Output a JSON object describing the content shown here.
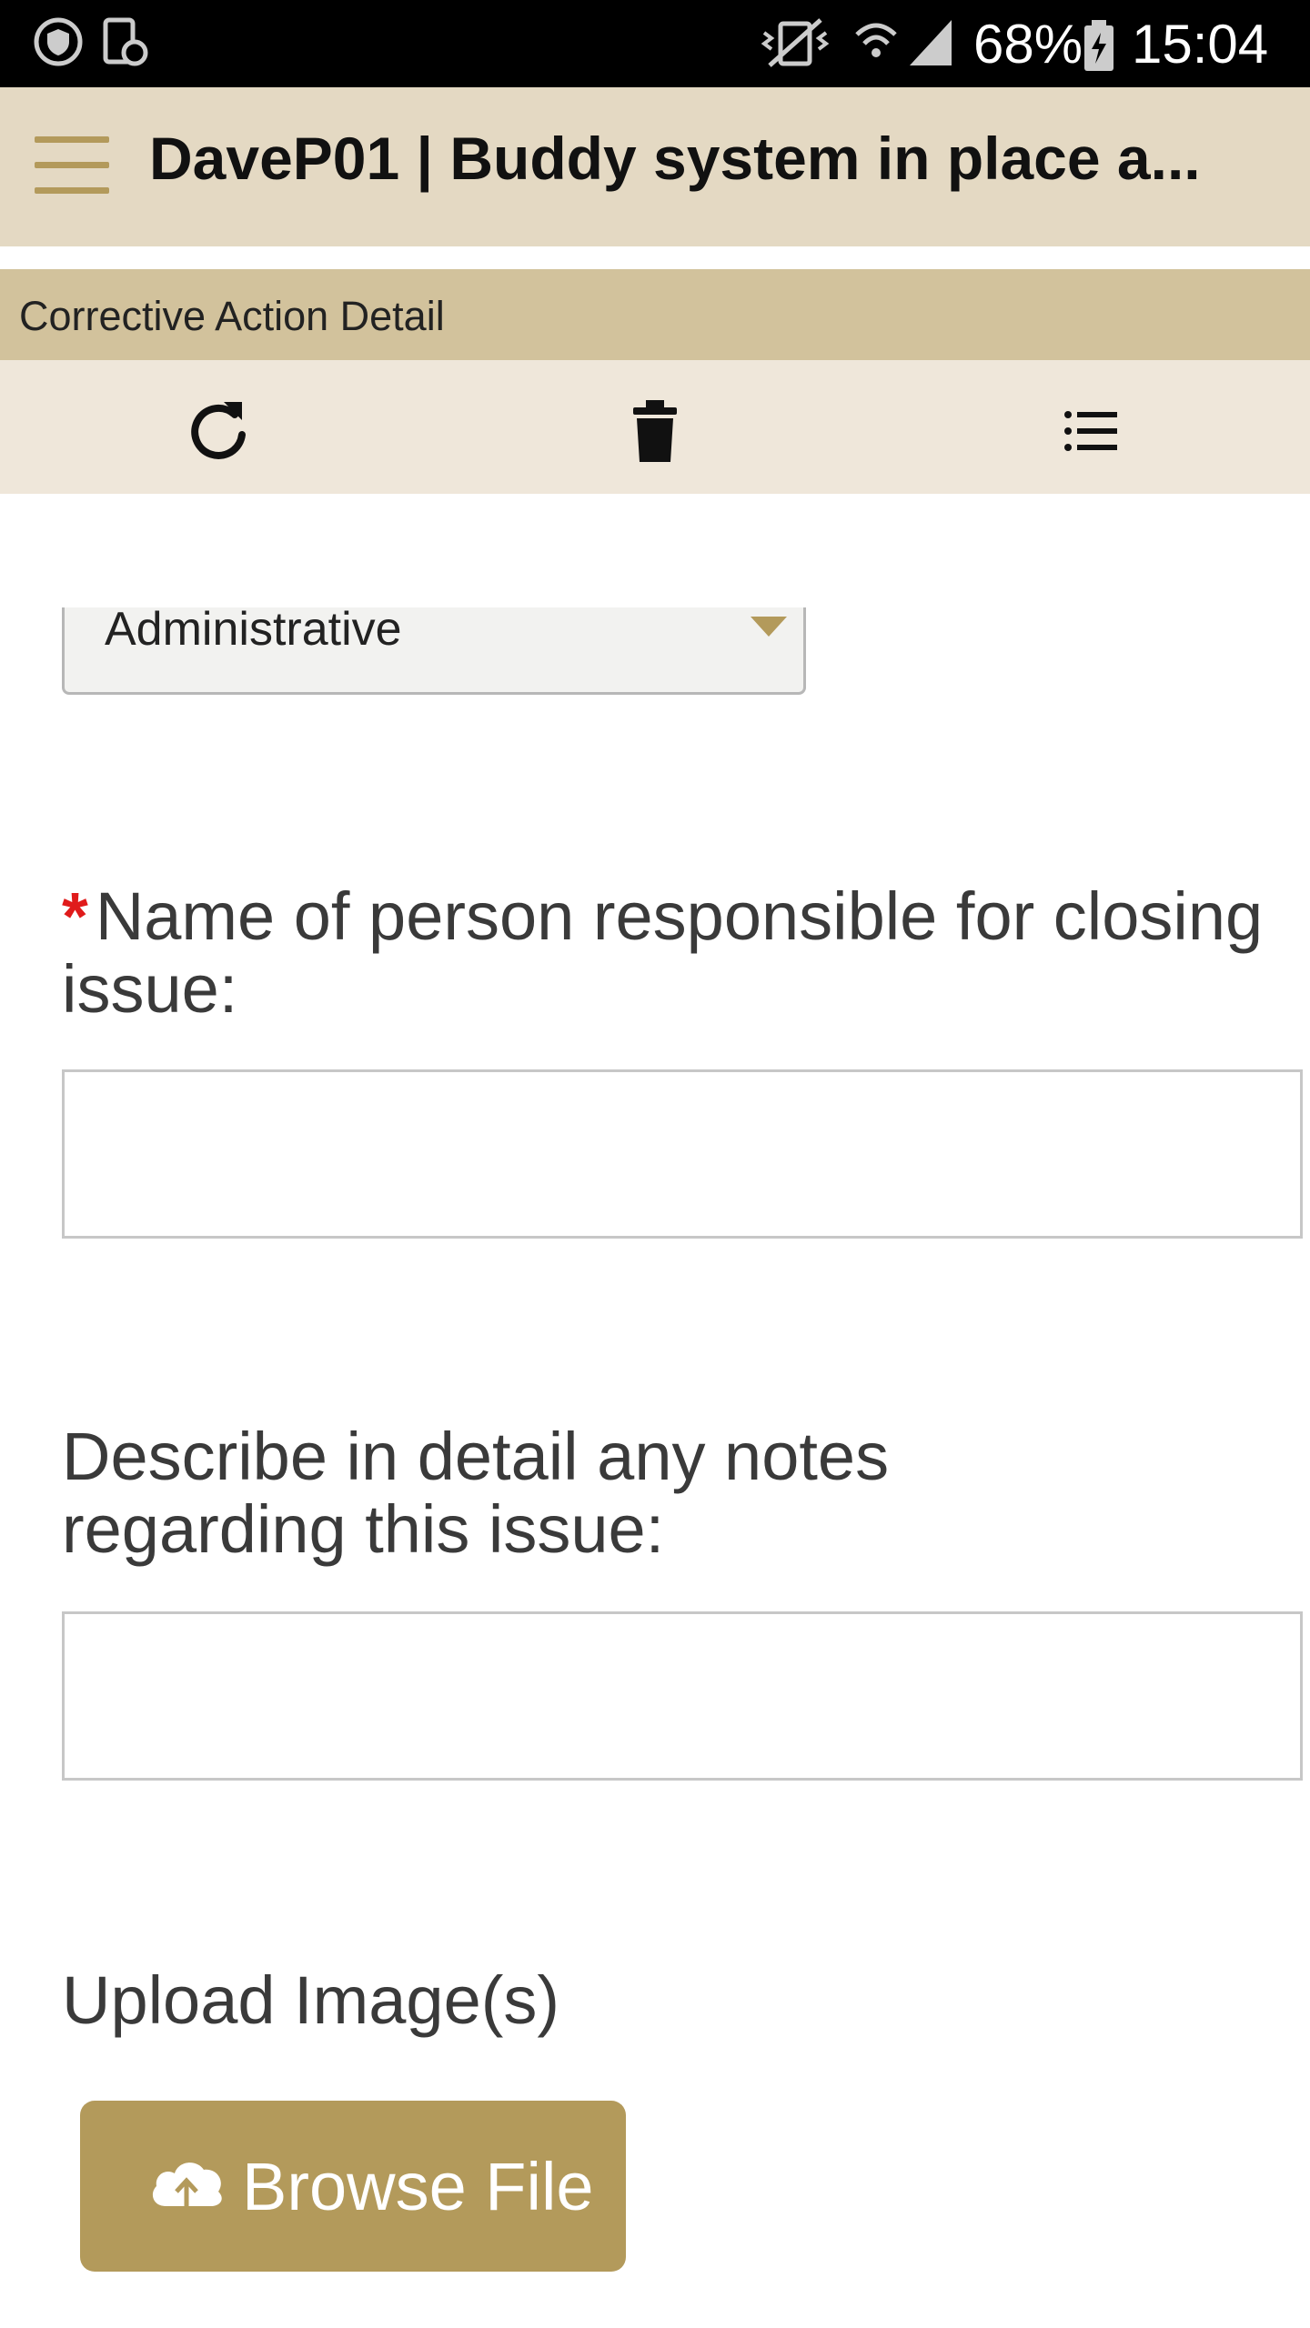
{
  "status_bar": {
    "battery_percent": "68%",
    "time": "15:04",
    "icons": [
      "shield-icon",
      "screen-lock-icon",
      "mute-vibrate-icon",
      "wifi-icon",
      "signal-icon",
      "battery-charging-icon"
    ]
  },
  "header": {
    "title": "DaveP01 | Buddy system in place a...",
    "menu_icon": "hamburger-menu-icon",
    "accent_color": "#b39a5b",
    "background": "#e4d9c3"
  },
  "section": {
    "title": "Corrective Action Detail"
  },
  "toolbar": {
    "buttons": [
      "refresh-icon",
      "trash-icon",
      "list-icon"
    ]
  },
  "form": {
    "category_select": {
      "value": "Administrative"
    },
    "responsible_person": {
      "required_marker": "*",
      "label": "Name of person responsible for closing issue:",
      "value": ""
    },
    "notes": {
      "label": "Describe in detail any notes regarding this issue:",
      "value": ""
    },
    "upload": {
      "label": "Upload Image(s)",
      "button_label": "Browse File",
      "button_icon": "cloud-upload-icon"
    }
  }
}
